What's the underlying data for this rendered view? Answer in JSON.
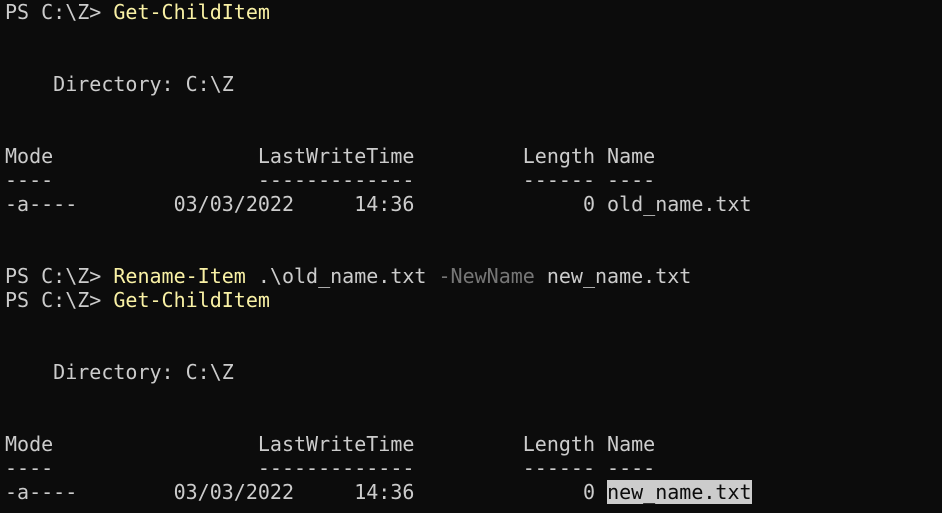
{
  "lines": [
    {
      "prompt": "PS C:\\Z> ",
      "command": "Get-ChildItem"
    },
    {
      "text": ""
    },
    {
      "text": ""
    },
    {
      "text": "    Directory: C:\\Z"
    },
    {
      "text": ""
    },
    {
      "text": ""
    },
    {
      "text": "Mode                 LastWriteTime         Length Name"
    },
    {
      "text": "----                 -------------         ------ ----"
    },
    {
      "text": "-a----        03/03/2022     14:36              0 old_name.txt"
    },
    {
      "text": ""
    },
    {
      "text": ""
    },
    {
      "prompt": "PS C:\\Z> ",
      "command": "Rename-Item",
      "arg1": " .\\old_name.txt ",
      "param": "-NewName",
      "arg2": " new_name.txt"
    },
    {
      "prompt": "PS C:\\Z> ",
      "command": "Get-ChildItem"
    },
    {
      "text": ""
    },
    {
      "text": ""
    },
    {
      "text": "    Directory: C:\\Z"
    },
    {
      "text": ""
    },
    {
      "text": ""
    },
    {
      "text": "Mode                 LastWriteTime         Length Name"
    },
    {
      "text": "----                 -------------         ------ ----"
    },
    {
      "prefix": "-a----        03/03/2022     14:36              0 ",
      "selected": "new_name.txt"
    }
  ]
}
